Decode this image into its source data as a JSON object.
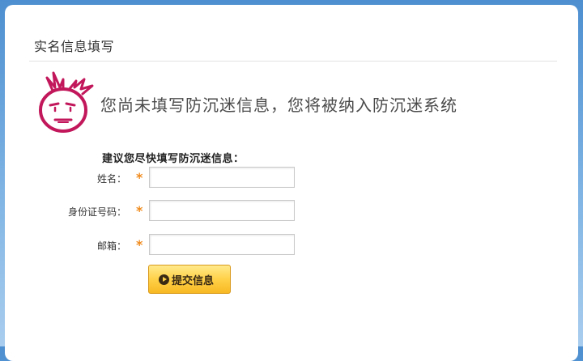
{
  "page": {
    "title": "实名信息填写",
    "headline": "您尚未填写防沉迷信息，您将被纳入防沉迷系统",
    "advise": "建议您尽快填写防沉迷信息："
  },
  "form": {
    "fields": [
      {
        "label": "姓名：",
        "required_mark": "*",
        "value": ""
      },
      {
        "label": "身份证号码：",
        "required_mark": "*",
        "value": ""
      },
      {
        "label": "邮箱：",
        "required_mark": "*",
        "value": ""
      }
    ],
    "submit_label": "提交信息"
  },
  "colors": {
    "required": "#f08a1c",
    "face": "#c2185b",
    "button": "#ffd148"
  },
  "icons": {
    "face": "worried-face-icon",
    "submit": "play-circle-icon"
  }
}
